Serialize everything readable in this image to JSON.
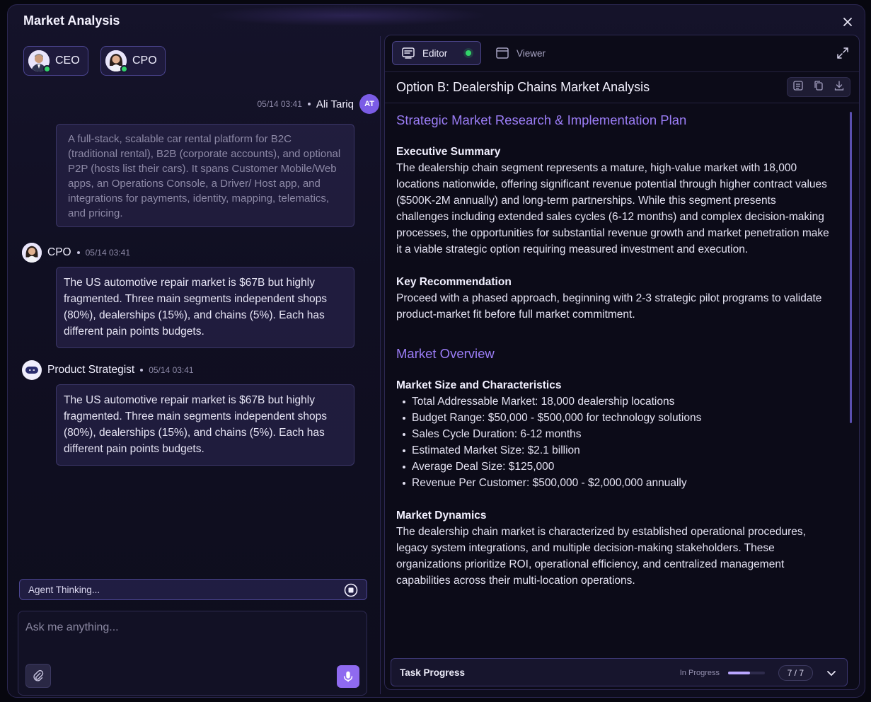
{
  "window": {
    "title": "Market Analysis"
  },
  "agents": [
    {
      "label": "CEO"
    },
    {
      "label": "CPO"
    }
  ],
  "user_message": {
    "time": "05/14 03:41",
    "name": "Ali Tariq",
    "initials": "AT",
    "text": "A full-stack, scalable car rental platform for B2C (traditional rental), B2B (corporate accounts), and optional P2P (hosts list their cars). It spans Customer Mobile/Web apps, an Operations Console, a Driver/ Host app, and integrations for payments, identity, mapping, telematics, and pricing."
  },
  "messages": [
    {
      "name": "CPO",
      "time": "05/14 03:41",
      "text": "The US automotive repair market is $67B but highly fragmented. Three main segments independent shops (80%), dealerships (15%), and chains (5%). Each has different pain points budgets."
    },
    {
      "name": "Product Strategist",
      "time": "05/14 03:41",
      "text": "The US automotive repair market is $67B but highly fragmented. Three main segments independent shops (80%), dealerships (15%), and chains (5%). Each has different pain points budgets."
    }
  ],
  "thinking": {
    "label": "Agent Thinking..."
  },
  "composer": {
    "placeholder": "Ask me anything..."
  },
  "tabs": {
    "editor": "Editor",
    "viewer": "Viewer"
  },
  "document": {
    "title": "Option B: Dealership Chains Market Analysis",
    "heading1": "Strategic Market Research & Implementation Plan",
    "exec_title": "Executive Summary",
    "exec_text": "The dealership chain segment represents a mature, high-value market with 18,000 locations nationwide, offering significant revenue potential through higher contract values ($500K-2M annually) and long-term partnerships. While this segment presents challenges including extended sales cycles (6-12 months) and complex decision-making processes, the opportunities for substantial revenue growth and market penetration make it a viable strategic option requiring measured investment and execution.",
    "rec_title": "Key Recommendation",
    "rec_text": "Proceed with a phased approach, beginning with 2-3 strategic pilot programs to validate product-market fit before full market commitment.",
    "heading2": "Market Overview",
    "size_title": "Market Size and Characteristics",
    "size_items": [
      "Total Addressable Market: 18,000 dealership locations",
      "Budget Range: $50,000 - $500,000 for technology solutions",
      "Sales Cycle Duration: 6-12 months",
      "Estimated Market Size: $2.1 billion",
      "Average Deal Size: $125,000",
      "Revenue Per Customer: $500,000 - $2,000,000 annually"
    ],
    "dyn_title": "Market Dynamics",
    "dyn_text": "The dealership chain market is characterized by established operational procedures, legacy system integrations, and multiple decision-making stakeholders. These organizations prioritize ROI, operational efficiency, and centralized management capabilities across their multi-location operations."
  },
  "task": {
    "label": "Task Progress",
    "status": "In Progress",
    "count": "7 / 7",
    "progress": 0.6
  },
  "colors": {
    "accent": "#9b7df6",
    "online": "#32d46a",
    "mic": "#8f6af0"
  }
}
